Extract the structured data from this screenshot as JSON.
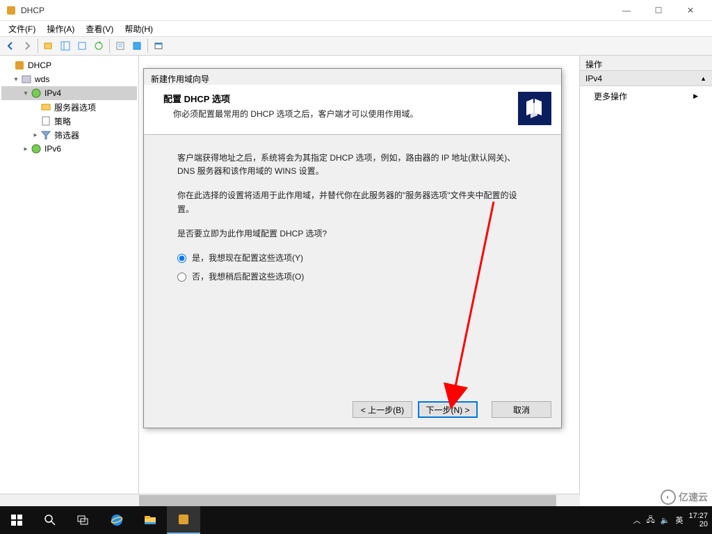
{
  "window": {
    "title": "DHCP",
    "minimize": "—",
    "maximize": "☐",
    "close": "✕"
  },
  "menu": {
    "file": "文件(F)",
    "action": "操作(A)",
    "view": "查看(V)",
    "help": "帮助(H)"
  },
  "tree": {
    "root": "DHCP",
    "server": "wds",
    "ipv4": "IPv4",
    "server_options": "服务器选项",
    "policies": "策略",
    "filters": "筛选器",
    "ipv6": "IPv6"
  },
  "actions": {
    "header": "操作",
    "subheader": "IPv4",
    "more": "更多操作"
  },
  "wizard": {
    "window_title": "新建作用域向导",
    "heading": "配置 DHCP 选项",
    "subheading": "你必须配置最常用的 DHCP 选项之后，客户端才可以使用作用域。",
    "para1": "客户端获得地址之后，系统将会为其指定 DHCP 选项，例如，路由器的 IP 地址(默认网关)、DNS 服务器和该作用域的 WINS 设置。",
    "para2": "你在此选择的设置将适用于此作用域，并替代你在此服务器的\"服务器选项\"文件夹中配置的设置。",
    "para3": "是否要立即为此作用域配置 DHCP 选项?",
    "radio_yes": "是，我想现在配置这些选项(Y)",
    "radio_no": "否，我想稍后配置这些选项(O)",
    "back": "< 上一步(B)",
    "next": "下一步(N) >",
    "cancel": "取消"
  },
  "taskbar": {
    "ime": "英",
    "time": "17:27",
    "date": "20"
  },
  "watermark": "亿速云"
}
